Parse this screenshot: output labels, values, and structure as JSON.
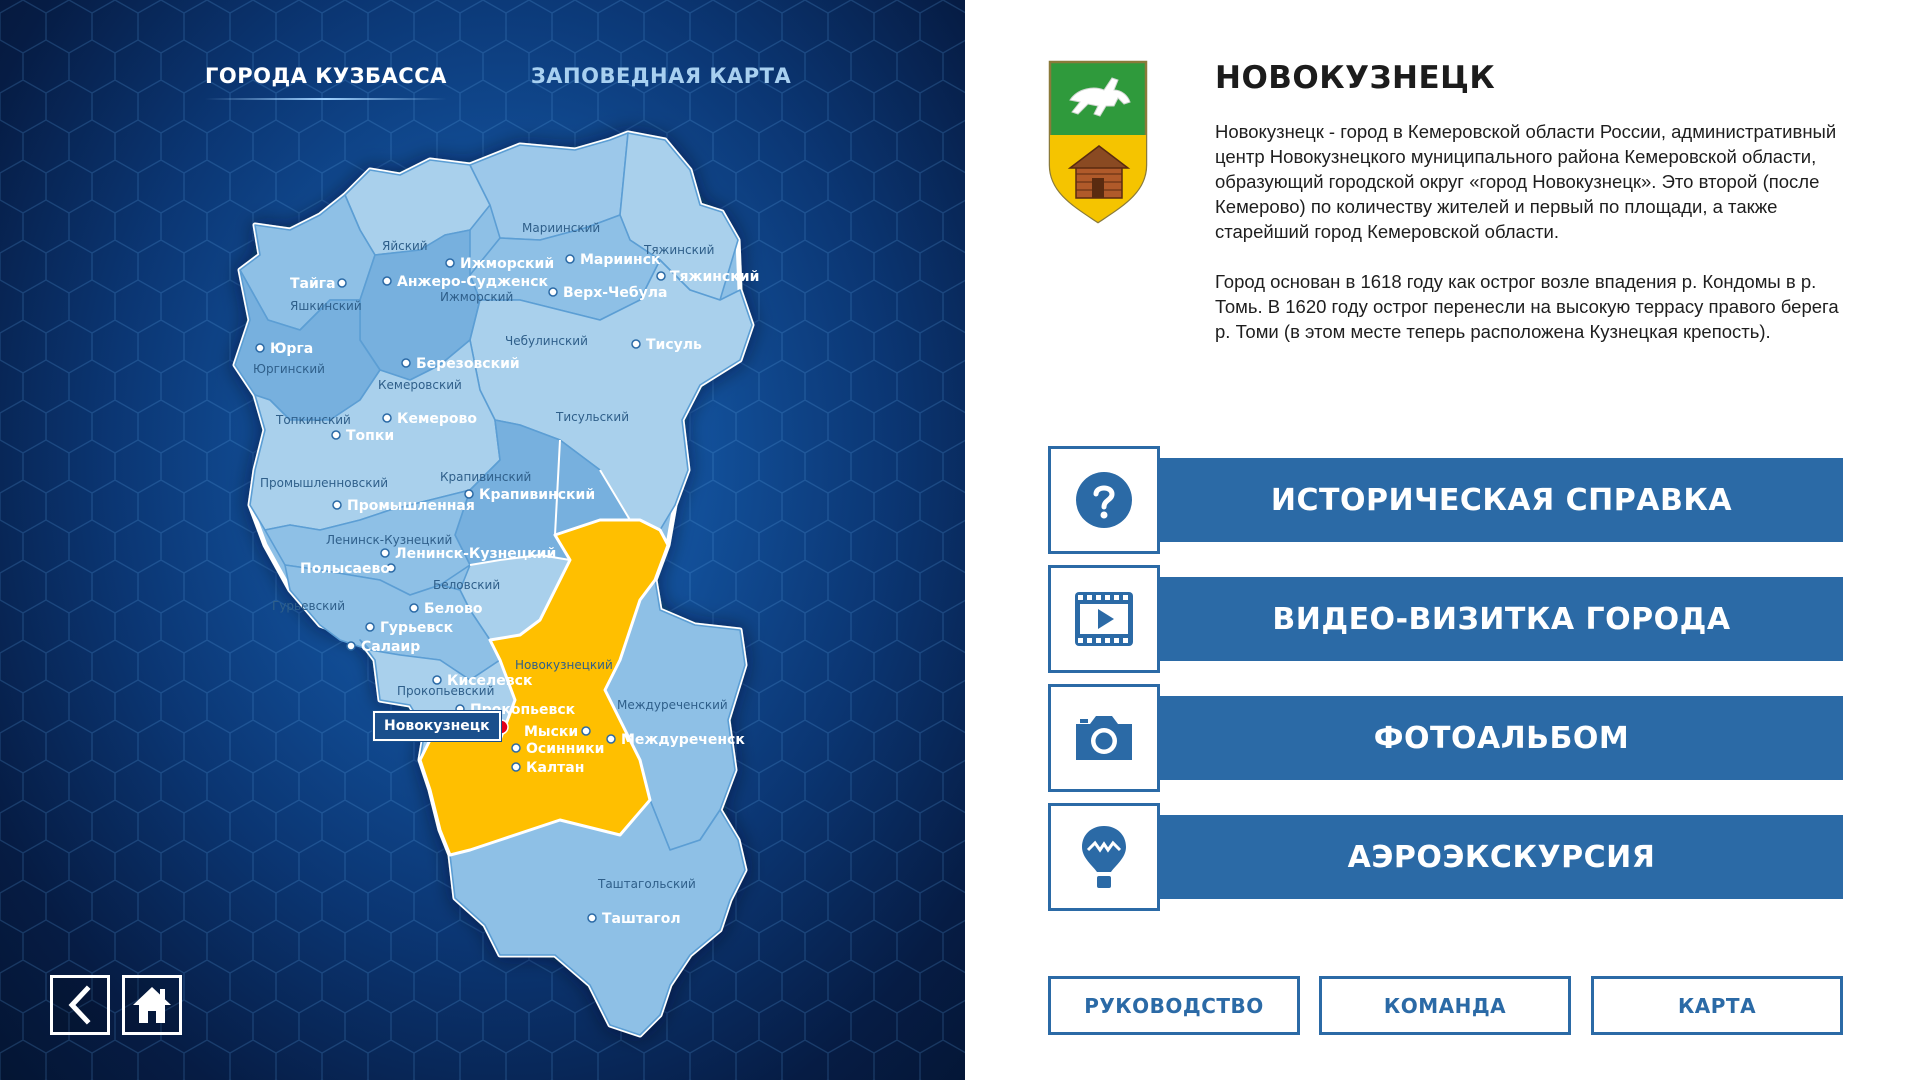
{
  "nav": {
    "tabs": [
      {
        "label": "ГОРОДА КУЗБАССА",
        "active": true
      },
      {
        "label": "ЗАПОВЕДНАЯ КАРТА",
        "active": false
      }
    ]
  },
  "map": {
    "selected_city_tooltip": "Новокузнецк",
    "selected_district_color": "#ffbf00",
    "district_color_light": "#a9d0ec",
    "district_color_mid": "#8ec0e6",
    "district_color_dark": "#77b0de",
    "district_labels": [
      "Яйский",
      "Мариинский",
      "Тяжинский",
      "Ижморский",
      "Яшкинский",
      "Юргинский",
      "Чебулинский",
      "Кемеровский",
      "Тисульский",
      "Топкинский",
      "Крапивинский",
      "Промышленновский",
      "Ленинск-Кузнецкий",
      "Беловский",
      "Гурьевский",
      "Новокузнецкий",
      "Прокопьевский",
      "Междуреченский",
      "Таштагольский"
    ],
    "cities": [
      "Тайга",
      "Ижморский",
      "Мариинск",
      "Анжеро-Судженск",
      "Тяжинский",
      "Верх-Чебула",
      "Юрга",
      "Тисуль",
      "Березовский",
      "Кемерово",
      "Топки",
      "Крапивинский",
      "Промышленная",
      "Ленинск-Кузнецкий",
      "Полысаево",
      "Белово",
      "Гурьевск",
      "Салаир",
      "Киселевск",
      "Прокопьевск",
      "Мыски",
      "Междуреченск",
      "Осинники",
      "Калтан",
      "Таштагол"
    ]
  },
  "controls": {
    "back_icon": "chevron-left-icon",
    "home_icon": "home-icon"
  },
  "city": {
    "title": "НОВОКУЗНЕЦК",
    "description_p1": "Новокузнецк - город в Кемеровской области России, административный центр Новокузнецкого муниципального района Кемеровской области, образующий городской округ «город Новокузнецк». Это второй (после Кемерово) по количеству жителей и первый по площади, а также старейший город Кемеровской области.",
    "description_p2": "Город основан в 1618 году как острог возле впадения р. Кондомы в р. Томь. В 1620 году острог перенесли на высокую террасу правого берега р. Томи (в этом месте теперь расположена Кузнецкая крепость)."
  },
  "actions": [
    {
      "label": "ИСТОРИЧЕСКАЯ СПРАВКА",
      "icon": "question-icon"
    },
    {
      "label": "ВИДЕО-ВИЗИТКА ГОРОДА",
      "icon": "video-icon"
    },
    {
      "label": "ФОТОАЛЬБОМ",
      "icon": "camera-icon"
    },
    {
      "label": "АЭРОЭКСКУРСИЯ",
      "icon": "balloon-icon"
    }
  ],
  "bottom_buttons": {
    "leadership": "РУКОВОДСТВО",
    "team": "КОМАНДА",
    "map": "КАРТА"
  },
  "colors": {
    "accent": "#2b6aa6",
    "selected_marker": "#e3001b"
  }
}
